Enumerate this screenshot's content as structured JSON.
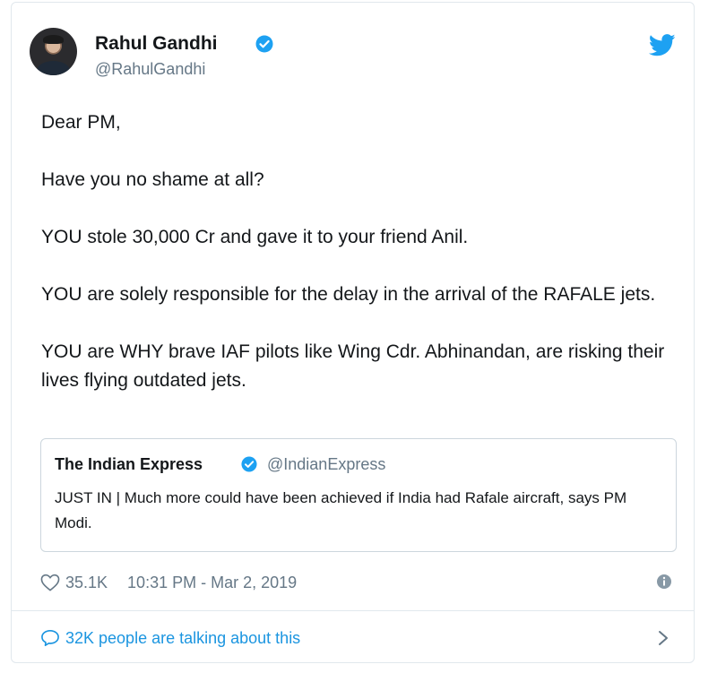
{
  "tweet": {
    "author_name": "Rahul Gandhi",
    "author_handle": "@RahulGandhi",
    "paragraphs": [
      "Dear PM,",
      "Have you no shame at all?",
      "YOU stole 30,000 Cr and gave it to your friend Anil.",
      "YOU are solely responsible for the delay in the arrival of the RAFALE jets.",
      "YOU are WHY brave IAF pilots like Wing Cdr. Abhinandan, are risking their lives flying outdated jets."
    ],
    "quoted": {
      "name": "The Indian Express",
      "handle": "@IndianExpress",
      "text": "JUST IN | Much more could have been achieved if India had Rafale aircraft, says PM Modi."
    },
    "likes": "35.1K",
    "timestamp": "10:31 PM - Mar 2, 2019",
    "talking": "32K people are talking about this"
  },
  "icons": {
    "verified": "verified-badge-icon",
    "brand": "twitter-bird-icon",
    "like": "heart-icon",
    "info": "info-icon",
    "conversation": "speech-bubble-icon",
    "more": "chevron-right-icon"
  },
  "colors": {
    "twitter_blue": "#1da1f2",
    "link_blue": "#1b95e0",
    "secondary_text": "#657786",
    "border": "#e1e8ed"
  }
}
